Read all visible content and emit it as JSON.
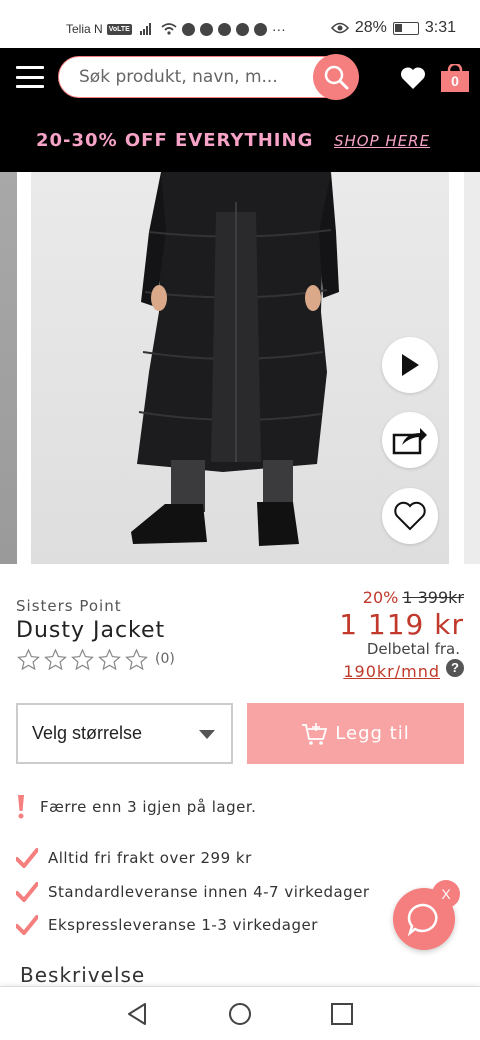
{
  "status_bar": {
    "carrier": "Telia N",
    "volte": "VoLTE",
    "battery": "28%",
    "time": "3:31",
    "more": "···"
  },
  "header": {
    "search_placeholder": "Søk produkt, navn, m...",
    "cart_count": "0",
    "promo_text": "20-30% OFF EVERYTHING",
    "promo_link": "SHOP HERE"
  },
  "product": {
    "brand": "Sisters Point",
    "title": "Dusty Jacket",
    "rating_stars": 0,
    "review_count": "(0)",
    "discount_pct": "20%",
    "old_price": "1 399kr",
    "price": "1 119 kr",
    "installment_label": "Delbetal fra.",
    "installment_price": "190kr/mnd",
    "help": "?"
  },
  "purchase": {
    "size_label": "Velg størrelse",
    "add_label": "Legg til"
  },
  "stock_warning": "Færre enn 3 igjen på lager.",
  "features": [
    "Alltid fri frakt over 299 kr",
    "Standardleveranse innen 4-7 virkedager",
    "Ekspressleveranse 1-3 virkedager"
  ],
  "description_heading": "Beskrivelse",
  "chat": {
    "close": "X"
  },
  "colors": {
    "accent": "#f57e7e",
    "promo": "#f7a3c8",
    "price": "#c0392b",
    "add_button": "#f9a4a4",
    "header_bg": "#000000"
  },
  "icons": {
    "menu": "hamburger-icon",
    "search": "search-icon",
    "wishlist": "heart-icon",
    "cart": "cart-icon",
    "play": "play-icon",
    "share": "share-icon",
    "favorite": "heart-outline-icon",
    "chat": "chat-bubble-icon"
  }
}
